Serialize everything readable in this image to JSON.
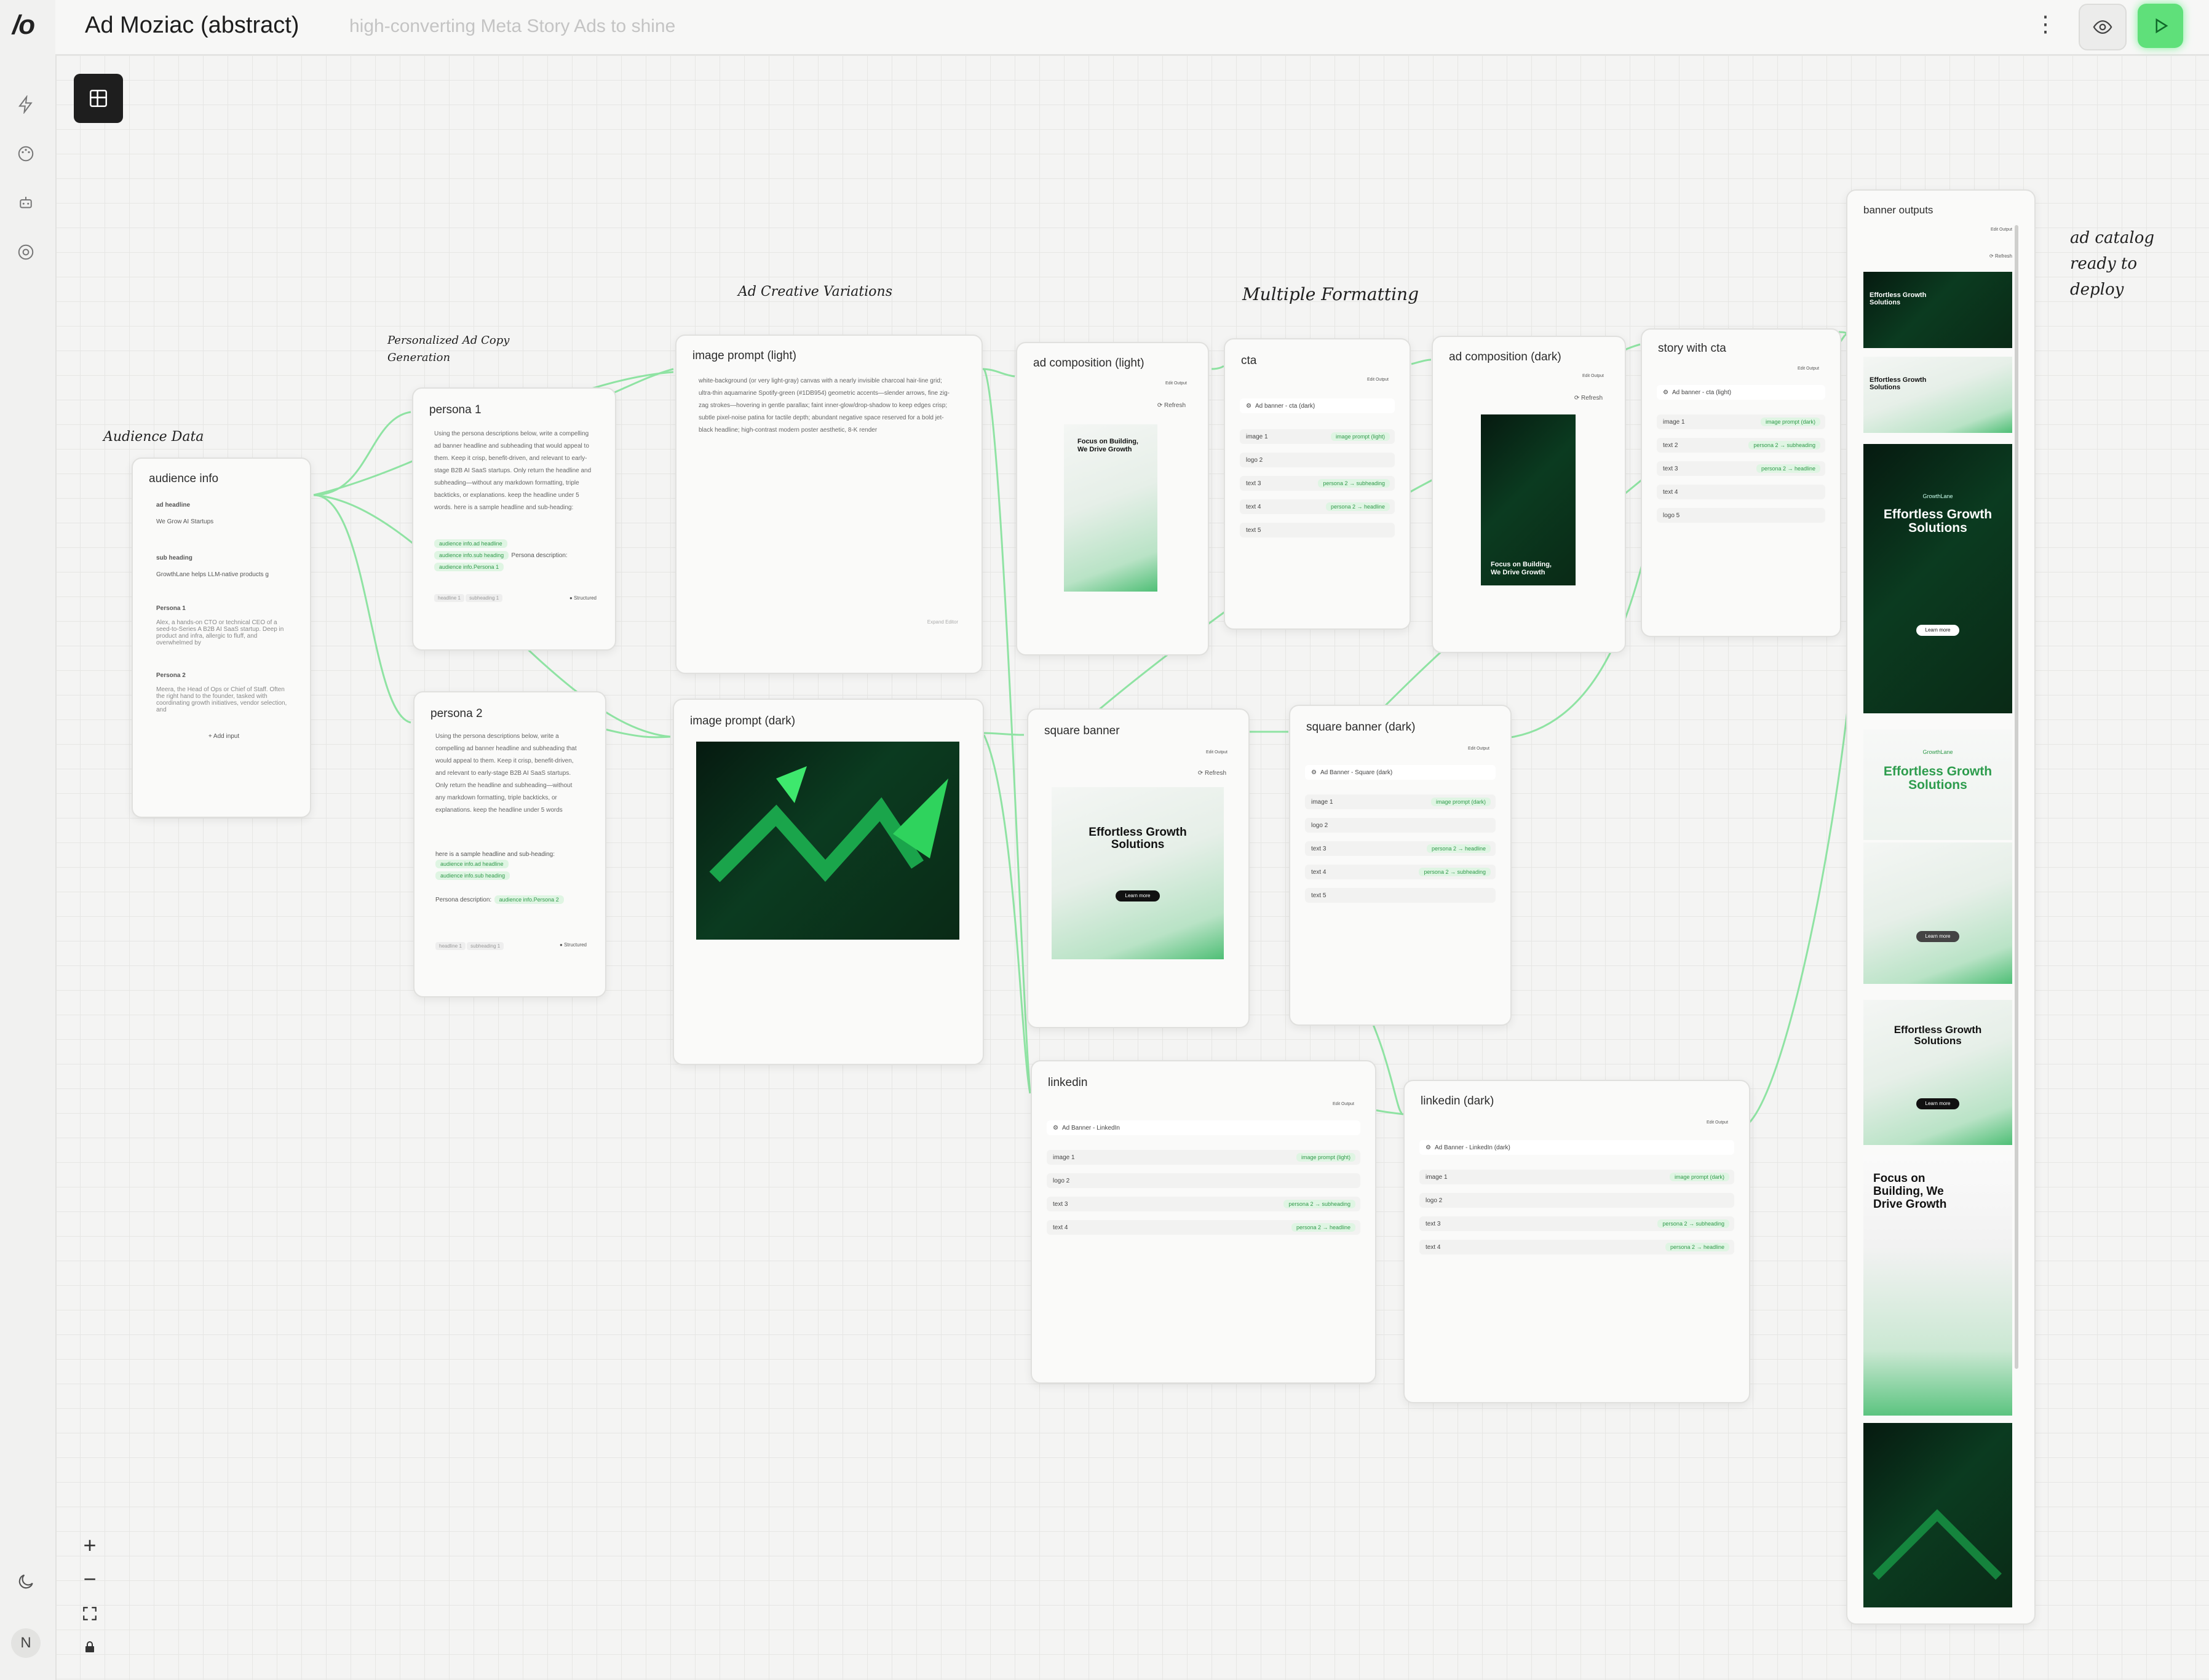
{
  "app": {
    "logo": "/o",
    "title": "Ad Moziac (abstract)",
    "subtitle": "high-converting Meta Story Ads to shine"
  },
  "annotations": {
    "audience": "Audience Data",
    "personalized": "Personalized Ad Copy Generation",
    "creative": "Ad Creative Variations",
    "formatting": "Multiple Formatting",
    "catalog": "ad catalog ready to deploy"
  },
  "audience_info": {
    "title": "audience info",
    "fields": [
      {
        "label": "ad headline",
        "value": "We Grow AI Startups"
      },
      {
        "label": "sub heading",
        "value": "GrowthLane helps LLM-native products g"
      },
      {
        "label": "Persona 1",
        "value": "Alex, a hands-on CTO or technical CEO of a seed-to-Series A B2B AI SaaS startup. Deep in product and infra, allergic to fluff, and overwhelmed by"
      },
      {
        "label": "Persona 2",
        "value": "Meera, the Head of Ops or Chief of Staff. Often the right hand to the founder, tasked with coordinating growth initiatives, vendor selection, and"
      }
    ],
    "add_input": "+ Add input"
  },
  "persona1": {
    "title": "persona 1",
    "prompt": "Using the persona descriptions below, write a compelling ad banner headline and subheading that would appeal to them. Keep it crisp, benefit-driven, and relevant to early-stage B2B AI SaaS startups. Only return the headline and subheading—without any markdown formatting, triple backticks, or explanations. keep the headline under 5 words. here is a sample headline and sub-heading:",
    "refs": [
      "audience info.ad headline",
      "audience info.sub heading",
      "audience info.Persona 1"
    ],
    "persona_desc": "Persona description:",
    "tags": [
      "headline 1",
      "subheading 1"
    ],
    "toggle": "Structured"
  },
  "persona2": {
    "title": "persona 2",
    "prompt": "Using the persona descriptions below, write a compelling ad banner headline and subheading that would appeal to them. Keep it crisp, benefit-driven, and relevant to early-stage B2B AI SaaS startups. Only return the headline and subheading—without any markdown formatting, triple backticks, or explanations. keep the headline under 5 words",
    "sample": "here is a sample headline and sub-heading:",
    "refs": [
      "audience info.ad headline",
      "audience info.sub heading"
    ],
    "persona_desc": "Persona description:",
    "persona_ref": "audience info.Persona 2",
    "tags": [
      "headline 1",
      "subheading 1"
    ],
    "toggle": "Structured"
  },
  "image_prompt_light": {
    "title": "image prompt (light)",
    "prompt": "white-background (or very light-gray) canvas with a nearly invisible charcoal hair-line grid; ultra-thin aquamarine Spotify-green (#1DB954) geometric accents—slender arrows, fine zig-zag strokes—hovering in gentle parallax; faint inner-glow/drop-shadow to keep edges crisp; subtle pixel-noise patina for tactile depth; abundant negative space reserved for a bold jet-black headline; high-contrast modern poster aesthetic, 8-K render",
    "footer": "Expand Editor"
  },
  "image_prompt_dark": {
    "title": "image prompt (dark)"
  },
  "ad_comp_light": {
    "title": "ad composition (light)",
    "refresh": "Refresh",
    "tabs": [
      "Edit",
      "Output"
    ],
    "headline": "Focus on Building, We Drive Growth"
  },
  "cta": {
    "title": "cta",
    "tabs": [
      "Edit",
      "Output"
    ],
    "template": "Ad banner - cta (dark)",
    "rows": [
      {
        "label": "image 1",
        "ref": "image prompt (light)"
      },
      {
        "label": "logo 2",
        "ref": ""
      },
      {
        "label": "text 3",
        "ref": "persona 2 → subheading"
      },
      {
        "label": "text 4",
        "ref": "persona 2 → headline"
      },
      {
        "label": "text 5",
        "ref": ""
      }
    ]
  },
  "ad_comp_dark": {
    "title": "ad composition (dark)",
    "refresh": "Refresh",
    "tabs": [
      "Edit",
      "Output"
    ],
    "headline": "Focus on Building, We Drive Growth"
  },
  "story_cta": {
    "title": "story with cta",
    "tabs": [
      "Edit",
      "Output"
    ],
    "template": "Ad banner - cta (light)",
    "rows": [
      {
        "label": "image 1",
        "ref": "image prompt (dark)"
      },
      {
        "label": "text 2",
        "ref": "persona 2 → subheading"
      },
      {
        "label": "text 3",
        "ref": "persona 2 → headline"
      },
      {
        "label": "text 4",
        "ref": ""
      },
      {
        "label": "logo 5",
        "ref": ""
      }
    ]
  },
  "square_banner": {
    "title": "square banner",
    "refresh": "Refresh",
    "tabs": [
      "Edit",
      "Output"
    ],
    "headline": "Effortless Growth Solutions",
    "button": "Learn more"
  },
  "square_dark": {
    "title": "square banner (dark)",
    "tabs": [
      "Edit",
      "Output"
    ],
    "template": "Ad Banner - Square (dark)",
    "rows": [
      {
        "label": "image 1",
        "ref": "image prompt (dark)"
      },
      {
        "label": "logo 2",
        "ref": ""
      },
      {
        "label": "text 3",
        "ref": "persona 2 → headline"
      },
      {
        "label": "text 4",
        "ref": "persona 2 → subheading"
      },
      {
        "label": "text 5",
        "ref": ""
      }
    ]
  },
  "linkedin": {
    "title": "linkedin",
    "tabs": [
      "Edit",
      "Output"
    ],
    "template": "Ad Banner - LinkedIn",
    "rows": [
      {
        "label": "image 1",
        "ref": "image prompt (light)"
      },
      {
        "label": "logo 2",
        "ref": ""
      },
      {
        "label": "text 3",
        "ref": "persona 2 → subheading"
      },
      {
        "label": "text 4",
        "ref": "persona 2 → headline"
      }
    ]
  },
  "linkedin_dark": {
    "title": "linkedin (dark)",
    "tabs": [
      "Edit",
      "Output"
    ],
    "template": "Ad Banner - LinkedIn (dark)",
    "rows": [
      {
        "label": "image 1",
        "ref": "image prompt (dark)"
      },
      {
        "label": "logo 2",
        "ref": ""
      },
      {
        "label": "text 3",
        "ref": "persona 2 → subheading"
      },
      {
        "label": "text 4",
        "ref": "persona 2 → headline"
      }
    ]
  },
  "outputs": {
    "title": "banner outputs",
    "tabs": [
      "Edit",
      "Output"
    ],
    "refresh": "Refresh",
    "headline_a": "Effortless Growth Solutions",
    "brand": "GrowthLane",
    "button": "Learn more",
    "headline_b": "Focus on Building, We Drive Growth"
  },
  "colors": {
    "accent": "#5fe07a",
    "wire": "#8fe3a3",
    "dark_green": "#0b3b20"
  },
  "user": {
    "avatar": "N"
  }
}
